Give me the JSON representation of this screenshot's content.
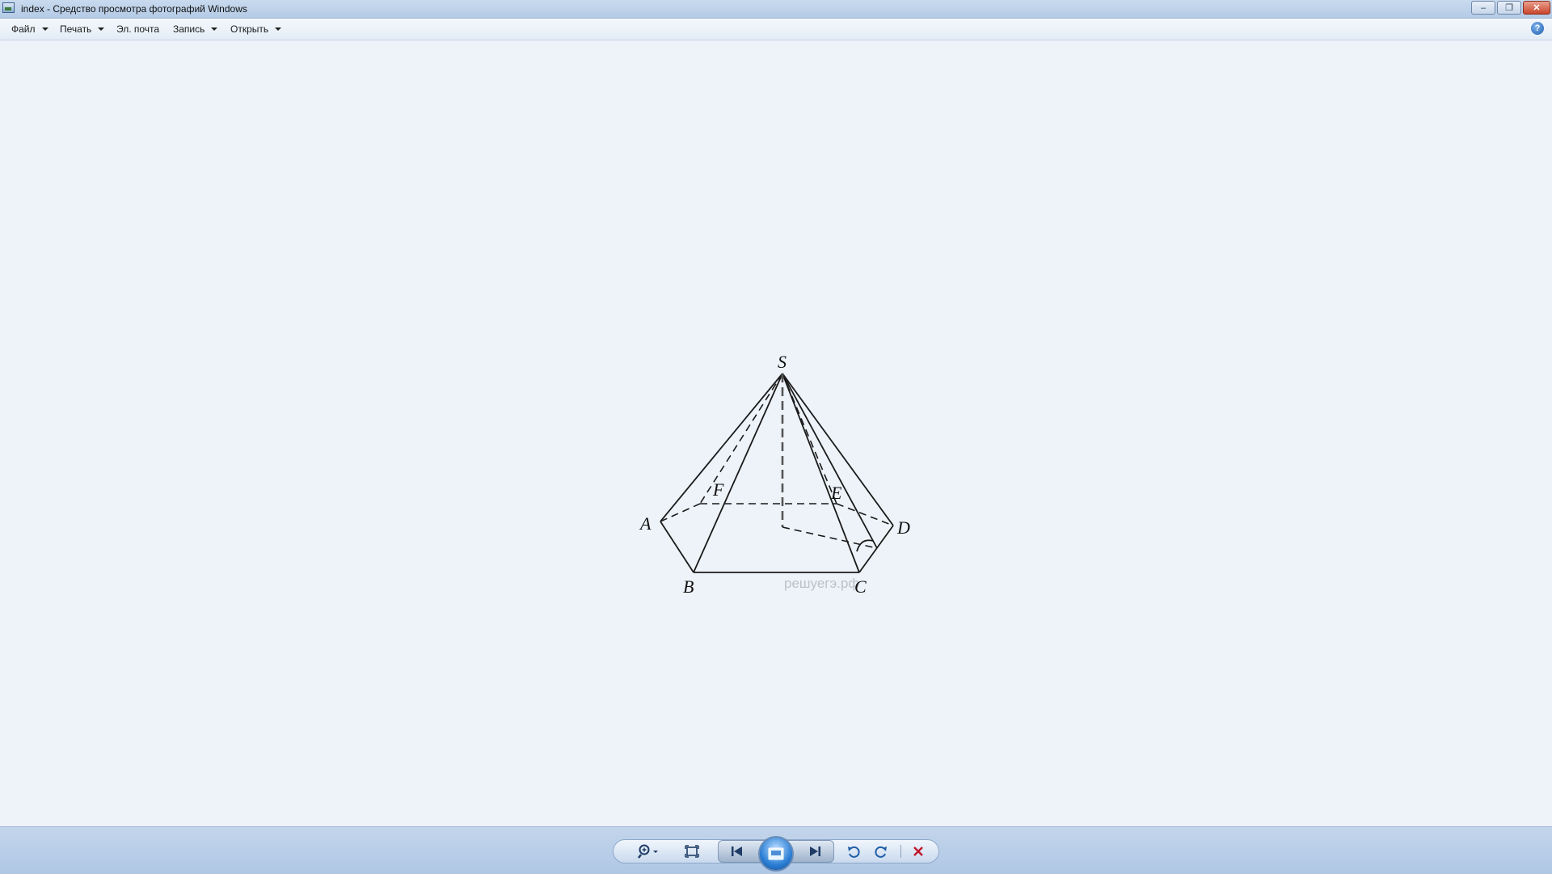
{
  "window": {
    "title": "index - Средство просмотра фотографий Windows"
  },
  "menu": {
    "items": [
      {
        "label": "Файл",
        "has_dropdown": true
      },
      {
        "label": "Печать",
        "has_dropdown": true
      },
      {
        "label": "Эл. почта",
        "has_dropdown": false
      },
      {
        "label": "Запись",
        "has_dropdown": true
      },
      {
        "label": "Открыть",
        "has_dropdown": true
      }
    ],
    "help_icon": "help-icon"
  },
  "image": {
    "vertex_labels": {
      "apex": "S",
      "a": "A",
      "b": "B",
      "c": "C",
      "d": "D",
      "e": "E",
      "f": "F"
    },
    "watermark": "решуегэ.рф"
  },
  "controls": {
    "icons": [
      "zoom-icon",
      "fit-to-window-icon",
      "previous-icon",
      "slideshow-icon",
      "next-icon",
      "rotate-counterclockwise-icon",
      "rotate-clockwise-icon",
      "delete-icon"
    ],
    "delete_color": "#c0182a",
    "accent": "#2b7fd6"
  }
}
